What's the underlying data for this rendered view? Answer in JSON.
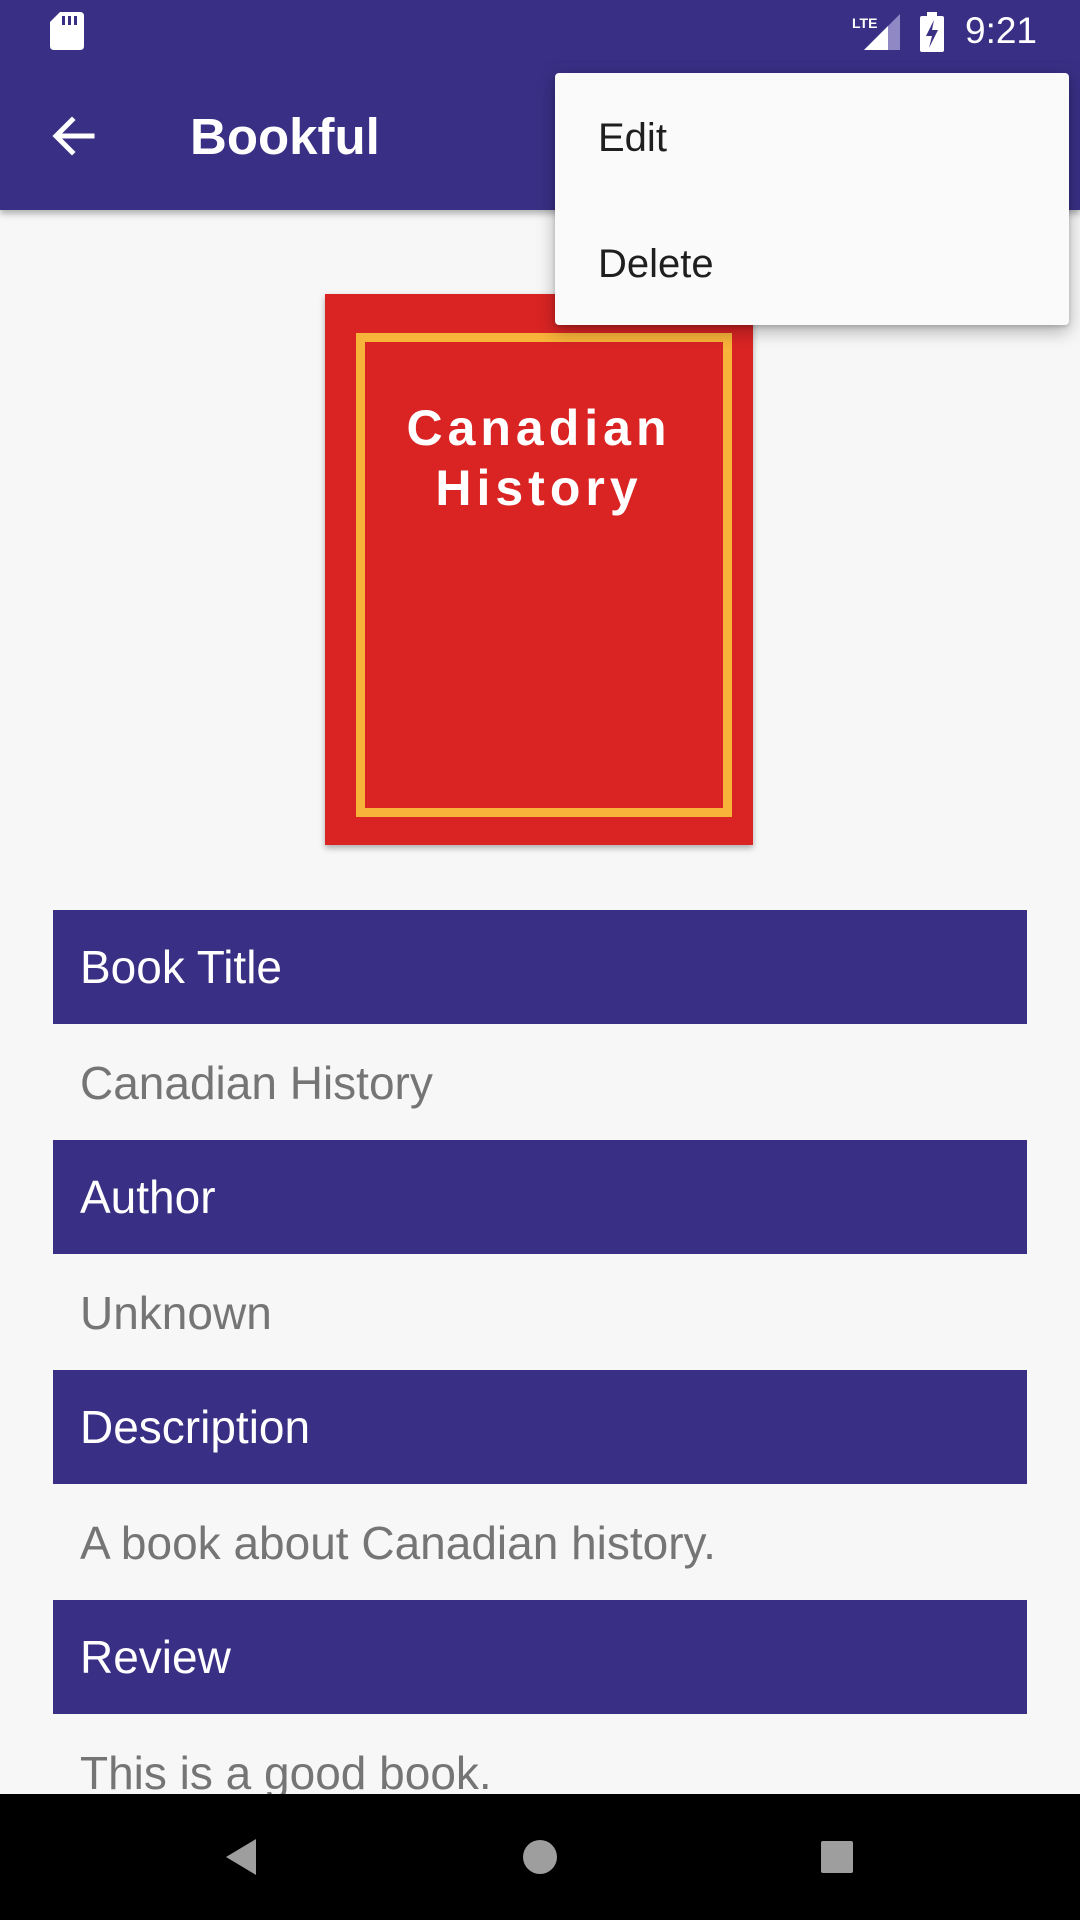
{
  "status_bar": {
    "time": "9:21",
    "network": "LTE",
    "icons": [
      "sd-card-icon",
      "lte-signal-icon",
      "battery-charging-icon"
    ]
  },
  "app_bar": {
    "title": "Bookful",
    "back_icon": "arrow-back-icon"
  },
  "cover": {
    "line1": "Canadian",
    "line2": "History"
  },
  "sections": [
    {
      "header": "Book Title",
      "value": "Canadian History"
    },
    {
      "header": "Author",
      "value": "Unknown"
    },
    {
      "header": "Description",
      "value": "A book about Canadian history."
    },
    {
      "header": "Review",
      "value": "This is a good book."
    }
  ],
  "menu": {
    "items": [
      {
        "label": "Edit"
      },
      {
        "label": "Delete"
      }
    ]
  },
  "nav_bar": {
    "icons": [
      "back-triangle-icon",
      "home-circle-icon",
      "recents-square-icon"
    ]
  },
  "colors": {
    "primary": "#392f85",
    "cover_red": "#da2424",
    "cover_frame": "#f7b33a",
    "background": "#f7f7f7",
    "value_text": "#757575"
  }
}
